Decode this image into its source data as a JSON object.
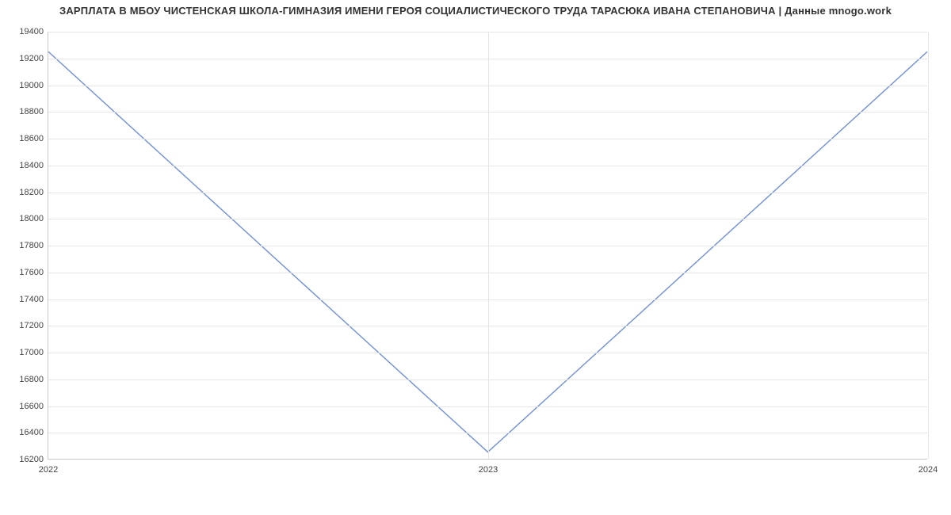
{
  "chart_data": {
    "type": "line",
    "title": "ЗАРПЛАТА В МБОУ ЧИСТЕНСКАЯ ШКОЛА-ГИМНАЗИЯ ИМЕНИ ГЕРОЯ СОЦИАЛИСТИЧЕСКОГО  ТРУДА ТАРАСЮКА ИВАНА СТЕПАНОВИЧА | Данные mnogo.work",
    "x": [
      "2022",
      "2023",
      "2024"
    ],
    "values": [
      19250,
      16250,
      19250
    ],
    "xlabel": "",
    "ylabel": "",
    "ylim": [
      16200,
      19400
    ],
    "y_ticks": [
      16200,
      16400,
      16600,
      16800,
      17000,
      17200,
      17400,
      17600,
      17800,
      18000,
      18200,
      18400,
      18600,
      18800,
      19000,
      19200,
      19400
    ],
    "x_ticks": [
      "2022",
      "2023",
      "2024"
    ],
    "line_color": "#6f8fd8"
  }
}
